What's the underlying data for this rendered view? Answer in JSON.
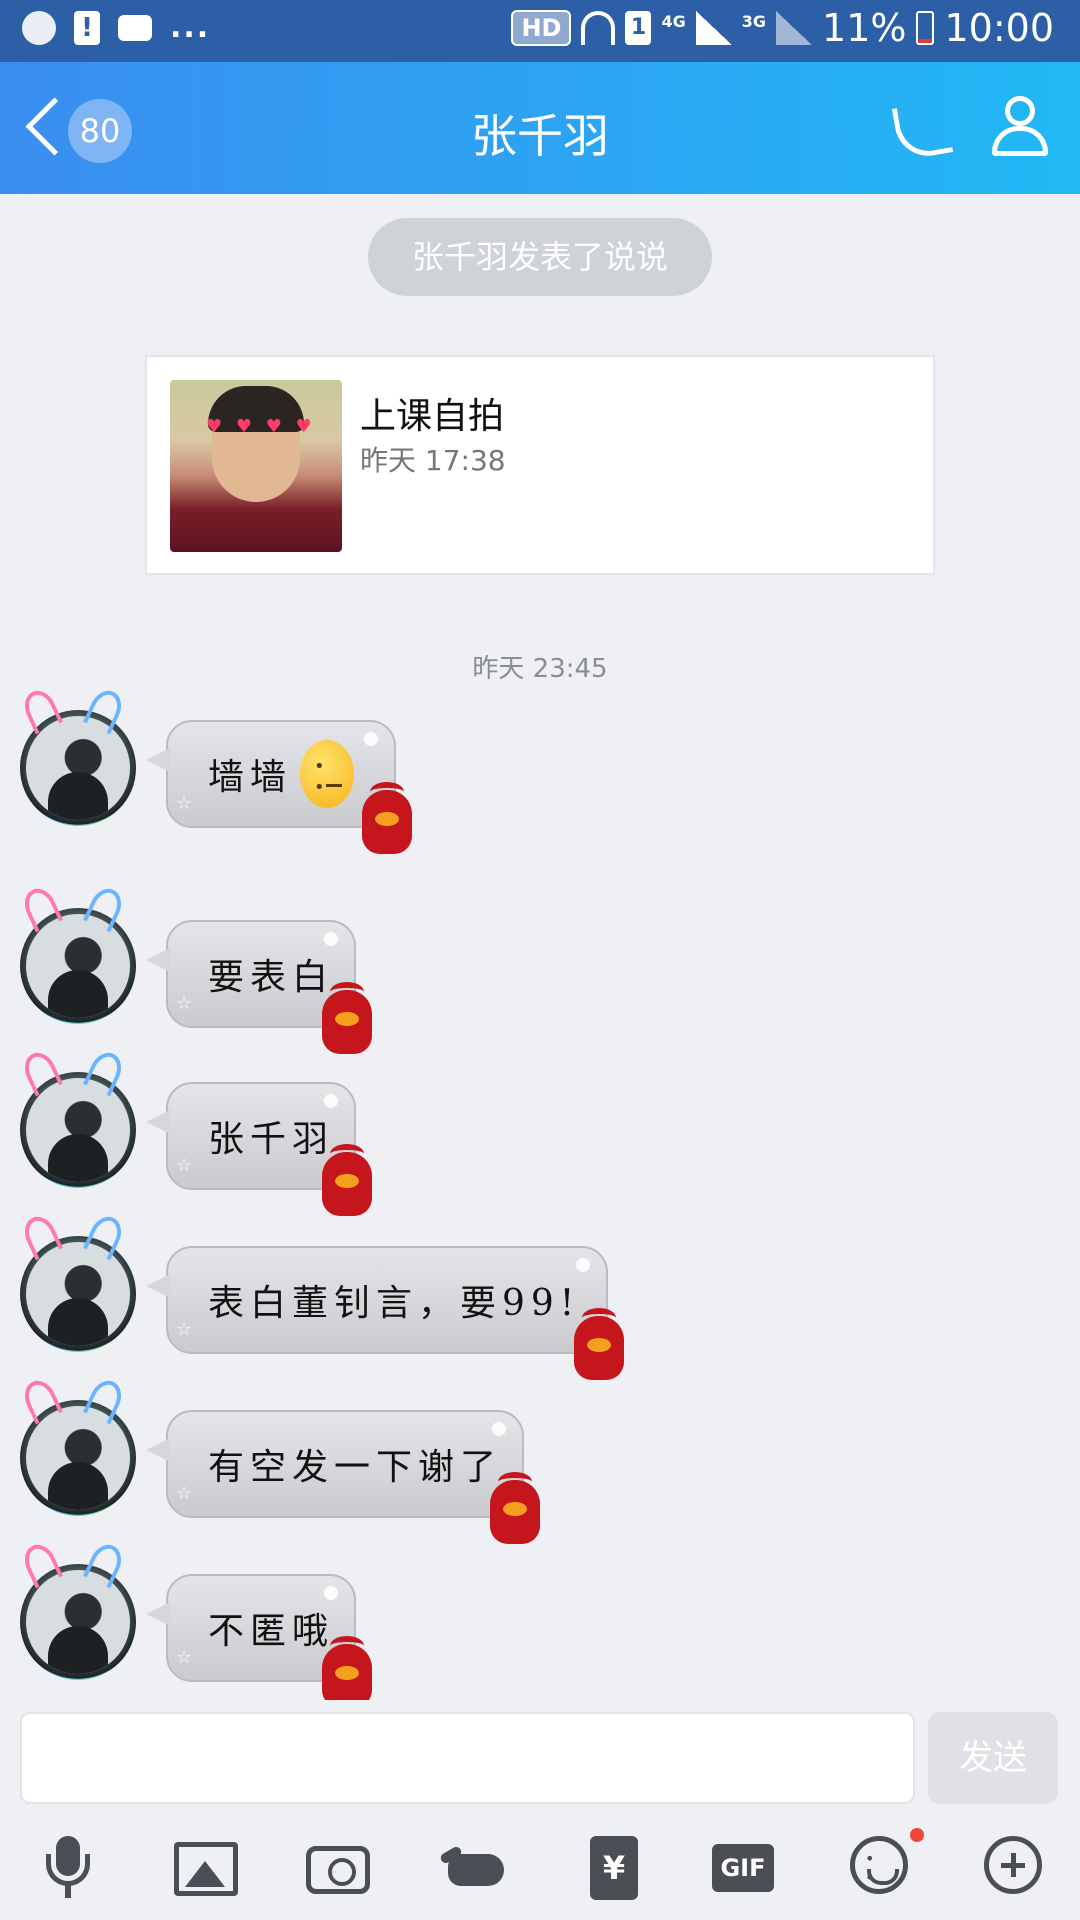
{
  "status_bar": {
    "hd": "HD",
    "sim": "1",
    "net1": "4G",
    "net2": "3G",
    "battery": "11%",
    "time": "10:00",
    "dots": "..."
  },
  "nav": {
    "unread_count": "80",
    "title": "张千羽"
  },
  "system_notice": "张千羽发表了说说",
  "shared_post": {
    "title": "上课自拍",
    "time": "昨天 17:38"
  },
  "timestamp": "昨天 23:45",
  "messages": [
    {
      "text": "墙墙",
      "emoji": "neutral-face"
    },
    {
      "text": "要表白"
    },
    {
      "text": "张千羽"
    },
    {
      "text": "表白董钊言，要99!"
    },
    {
      "text": "有空发一下谢了"
    },
    {
      "text": "不匿哦"
    }
  ],
  "input": {
    "placeholder": "",
    "send_label": "发送"
  },
  "toolbar": {
    "red_packet_glyph": "¥",
    "gif_label": "GIF",
    "icons": [
      "mic-icon",
      "image-icon",
      "camera-icon",
      "poke-icon",
      "red-packet-icon",
      "gif-icon",
      "emoji-icon",
      "plus-icon"
    ]
  },
  "colors": {
    "nav_gradient_start": "#3a8ef0",
    "nav_gradient_end": "#21b8f5",
    "status_bar": "#2d5fa6",
    "notification_dot": "#f04438"
  }
}
